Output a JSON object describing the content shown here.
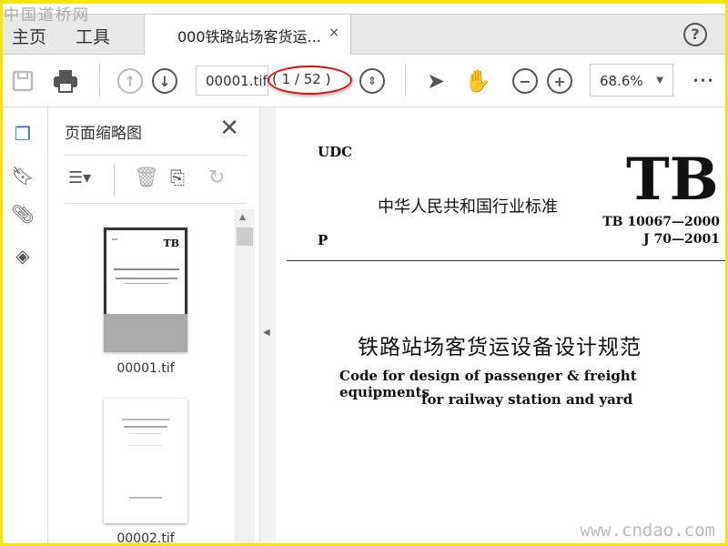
{
  "watermarks": {
    "top_left": "中国道桥网",
    "bottom_right": "www.cndao.com"
  },
  "tabs": {
    "home": "主页",
    "tools": "工具",
    "document": "000铁路站场客货运...",
    "close": "×",
    "help": "?"
  },
  "toolbar": {
    "page_input": "00001.tif",
    "page_count": "( 1 / 52 )",
    "zoom": "68.6%",
    "more": "•••"
  },
  "panel": {
    "title": "页面缩略图",
    "thumbnails": [
      {
        "label": "00001.tif"
      },
      {
        "label": "00002.tif"
      }
    ]
  },
  "document": {
    "udc": "UDC",
    "p": "P",
    "category": "中华人民共和国行业标准",
    "logo": "TB",
    "code1": "TB 10067—2000",
    "code2": "J 70—2001",
    "title_cn": "铁路站场客货运设备设计规范",
    "title_en_1": "Code for design of passenger & freight equipments",
    "title_en_2": "for railway station and yard"
  },
  "colors": {
    "border": "#f7e30f",
    "highlight_oval": "#e01010",
    "hand_tool": "#1a73c9"
  }
}
